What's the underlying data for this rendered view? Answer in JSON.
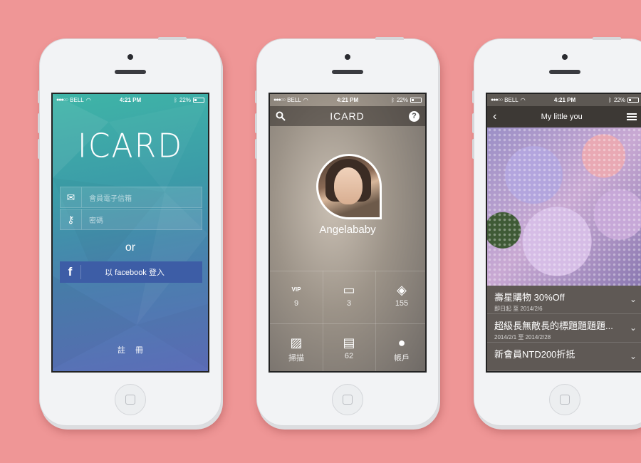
{
  "status_bar": {
    "dots": "●●●○○",
    "carrier": "BELL",
    "time": "4:21 PM",
    "battery": "22%"
  },
  "login_screen": {
    "logo": "ICARD",
    "email_placeholder": "會員電子信箱",
    "password_placeholder": "密碼",
    "or_text": "or",
    "facebook_label": "以 facebook 登入",
    "facebook_icon": "f",
    "register_label": "註冊"
  },
  "profile_screen": {
    "logo": "ICARD",
    "help_icon": "?",
    "user_name": "Angelababy",
    "stats": [
      {
        "icon": "vip-card-icon",
        "glyph": "VIP",
        "value": "9"
      },
      {
        "icon": "credit-card-icon",
        "glyph": "▭",
        "value": "3"
      },
      {
        "icon": "tag-icon",
        "glyph": "◈",
        "value": "155"
      }
    ],
    "actions": [
      {
        "icon": "scan-icon",
        "glyph": "▨",
        "label": "掃描"
      },
      {
        "icon": "cart-document-icon",
        "glyph": "▤",
        "label": "62"
      },
      {
        "icon": "account-icon",
        "glyph": "●",
        "label": "帳戶"
      }
    ]
  },
  "deals_screen": {
    "title": "My little you",
    "back_icon": "‹",
    "deals": [
      {
        "title": "壽星購物 30%Off",
        "date": "即日起 至 2014/2/6"
      },
      {
        "title": "超級長無敵長的標題題題題...",
        "date": "2014/2/1 至 2014/2/28"
      },
      {
        "title": "新會員NTD200折抵",
        "date": ""
      }
    ]
  },
  "colors": {
    "background": "#ef9696",
    "facebook": "#3d5da6"
  }
}
